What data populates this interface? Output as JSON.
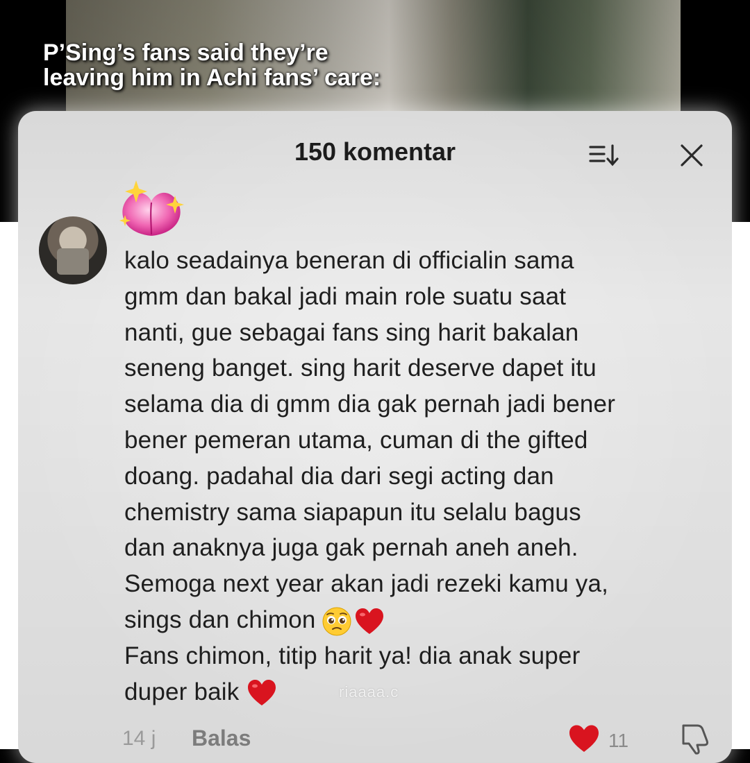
{
  "caption": {
    "line1": "P’Sing’s fans said they’re",
    "line2": "leaving him in Achi fans’ care:"
  },
  "comments_sheet": {
    "title": "150 komentar",
    "sort_icon": "sort-icon",
    "close_icon": "close-icon"
  },
  "comment": {
    "sticker": "peach-sparkle-sticker",
    "lines": [
      "kalo seadainya beneran di officialin sama",
      "gmm dan bakal jadi main role suatu saat",
      "nanti, gue sebagai fans sing harit bakalan",
      "seneng banget. sing harit deserve dapet itu",
      "selama dia di gmm dia gak pernah jadi bener",
      "bener pemeran utama, cuman di the gifted",
      "doang. padahal dia dari segi acting dan",
      "chemistry sama siapapun itu selalu bagus",
      "dan anaknya juga gak pernah aneh aneh.",
      "Semoga next year akan jadi rezeki kamu ya,",
      "sings dan chimon",
      "Fans chimon, titip harit ya! dia anak super",
      "duper baik"
    ],
    "time": "14 j",
    "reply_label": "Balas",
    "like_count": "11"
  },
  "watermark": "riaaaa.c",
  "colors": {
    "heart": "#d9141f",
    "sticker_pink": "#e8338c",
    "text": "#1e1e1e"
  }
}
